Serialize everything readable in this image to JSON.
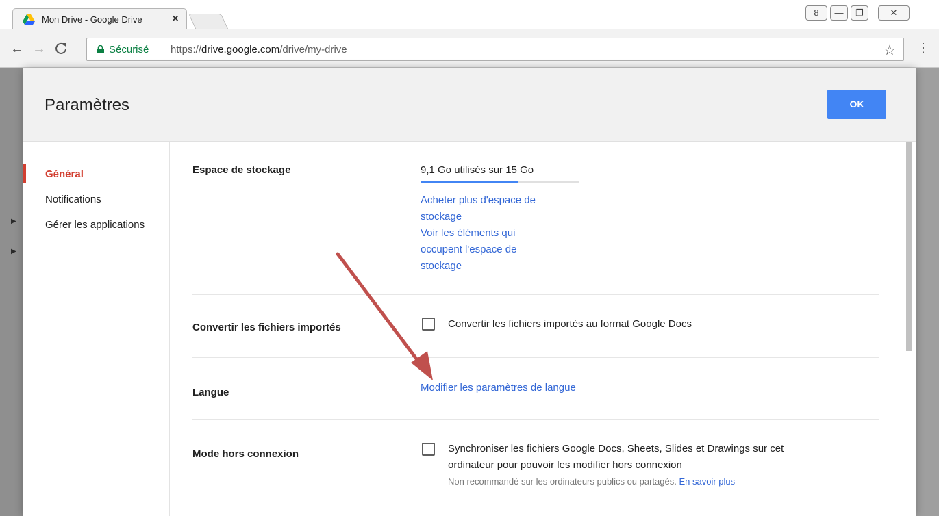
{
  "browser": {
    "tab_title": "Mon Drive - Google Drive",
    "tab_close": "×",
    "secure_label": "Sécurisé",
    "url_scheme": "https://",
    "url_host": "drive.google.com",
    "url_path": "/drive/my-drive",
    "profile_glyph": "8",
    "min_glyph": "—",
    "max_glyph": "❐",
    "close_glyph": "✕"
  },
  "dialog": {
    "title": "Paramètres",
    "ok_label": "OK",
    "sidebar": [
      {
        "label": "Général",
        "active": true
      },
      {
        "label": "Notifications",
        "active": false
      },
      {
        "label": "Gérer les applications",
        "active": false
      }
    ],
    "storage": {
      "label": "Espace de stockage",
      "usage": "9,1 Go utilisés sur 15 Go",
      "used_fraction": 0.61,
      "buy_link_line1": "Acheter plus d'espace de",
      "buy_link_line2": "stockage",
      "view_link_line1": "Voir les éléments qui",
      "view_link_line2": "occupent l'espace de",
      "view_link_line3": "stockage"
    },
    "convert": {
      "label": "Convertir les fichiers importés",
      "checkbox_label": "Convertir les fichiers importés au format Google Docs",
      "checked": false
    },
    "language": {
      "label": "Langue",
      "link": "Modifier les paramètres de langue"
    },
    "offline": {
      "label": "Mode hors connexion",
      "checkbox_label_line1": "Synchroniser les fichiers Google Docs, Sheets, Slides et Drawings sur cet",
      "checkbox_label_line2": "ordinateur pour pouvoir les modifier hors connexion",
      "note": "Non recommandé sur les ordinateurs publics ou partagés.",
      "note_link": "En savoir plus",
      "checked": false
    }
  },
  "colors": {
    "accent_blue": "#4285f4",
    "link_blue": "#3367d6",
    "active_red": "#d23f31",
    "annotation_arrow": "#c0504d"
  }
}
